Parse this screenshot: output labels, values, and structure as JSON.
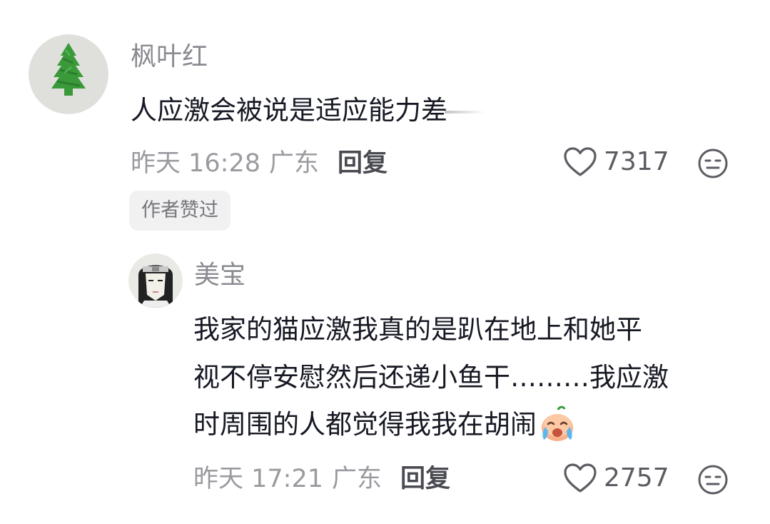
{
  "comment": {
    "username": "枫叶红",
    "text": "人应激会被说是适应能力差",
    "time": "昨天 16:28",
    "location": "广东",
    "reply_label": "回复",
    "likes": "7317",
    "author_liked_badge": "作者赞过",
    "avatar_icon": "green-tree-avatar"
  },
  "reply": {
    "username": "美宝",
    "text_lines": [
      "我家的猫应激我真的是趴在地上和她平",
      "视不停安慰然后还递小鱼干………我应激",
      "时周围的人都觉得我我在胡闹"
    ],
    "emoji": "crying-face-emoji",
    "time": "昨天 17:21",
    "location": "广东",
    "reply_label": "回复",
    "likes": "2757",
    "avatar_icon": "anime-character-avatar"
  },
  "icons": {
    "like": "heart-outline-icon",
    "dislike": "meh-face-icon"
  },
  "colors": {
    "text_primary": "#161823",
    "text_secondary": "#9a9ba0",
    "badge_bg": "#f1f1f2",
    "tree_green": "#3a9a3a"
  }
}
